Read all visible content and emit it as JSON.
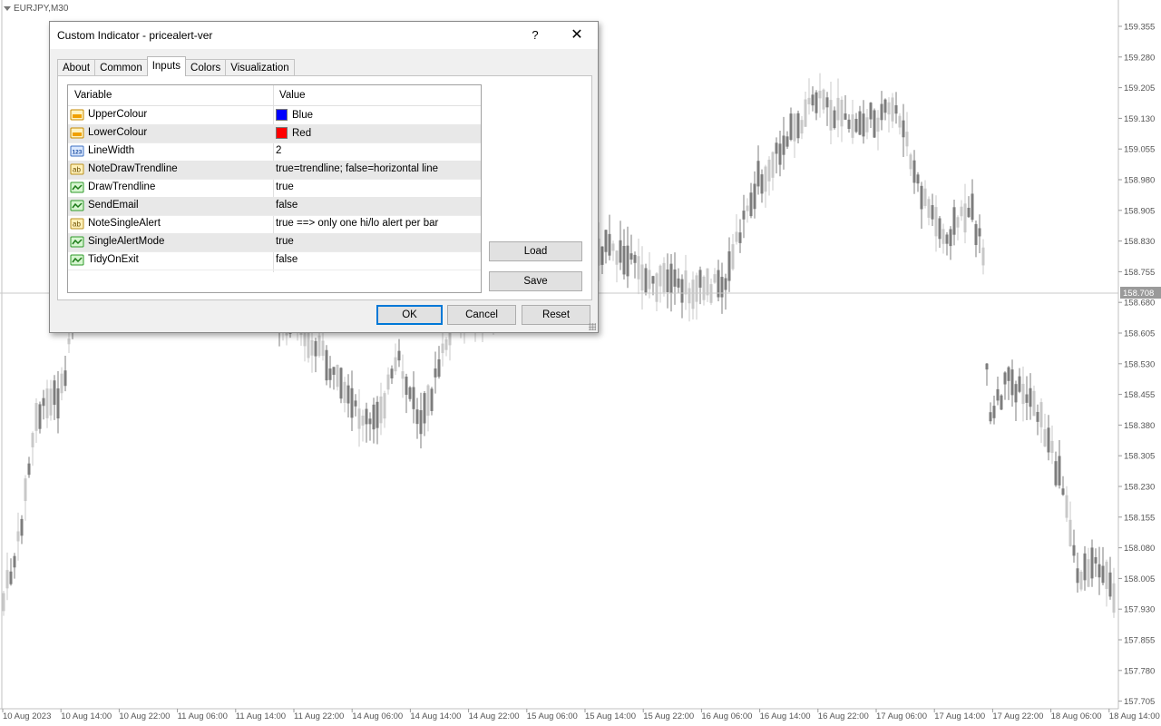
{
  "chart": {
    "symbol": "EURJPY,M30",
    "price_levels": [
      "159.355",
      "159.280",
      "159.205",
      "159.130",
      "159.055",
      "158.980",
      "158.905",
      "158.830",
      "158.755",
      "158.680",
      "158.605",
      "158.530",
      "158.455",
      "158.380",
      "158.305",
      "158.230",
      "158.155",
      "158.080",
      "158.005",
      "157.930",
      "157.855",
      "157.780",
      "157.705"
    ],
    "current_price": "158.708",
    "time_labels": [
      "10 Aug 2023",
      "10 Aug 14:00",
      "10 Aug 22:00",
      "11 Aug 06:00",
      "11 Aug 14:00",
      "11 Aug 22:00",
      "14 Aug 06:00",
      "14 Aug 14:00",
      "14 Aug 22:00",
      "15 Aug 06:00",
      "15 Aug 14:00",
      "15 Aug 22:00",
      "16 Aug 06:00",
      "16 Aug 14:00",
      "16 Aug 22:00",
      "17 Aug 06:00",
      "17 Aug 14:00",
      "17 Aug 22:00",
      "18 Aug 06:00",
      "18 Aug 14:00"
    ],
    "colors": {
      "candle_dark": "#7d7d7d",
      "candle_light": "#c8c8c8",
      "price_tag_bg": "#9a9a9a"
    }
  },
  "dialog": {
    "title": "Custom Indicator - pricealert-ver",
    "help_label": "?",
    "close_label": "✕",
    "tabs": [
      {
        "label": "About"
      },
      {
        "label": "Common"
      },
      {
        "label": "Inputs"
      },
      {
        "label": "Colors"
      },
      {
        "label": "Visualization"
      }
    ],
    "active_tab": "Inputs",
    "grid": {
      "col_variable": "Variable",
      "col_value": "Value",
      "rows": [
        {
          "variable": "UpperColour",
          "value": "Blue",
          "icon": "color-icon",
          "swatch": "#0000ff"
        },
        {
          "variable": "LowerColour",
          "value": "Red",
          "icon": "color-icon",
          "swatch": "#ff0000"
        },
        {
          "variable": "LineWidth",
          "value": "2",
          "icon": "integer-icon"
        },
        {
          "variable": "NoteDrawTrendline",
          "value": "true=trendline; false=horizontal line",
          "icon": "string-icon"
        },
        {
          "variable": "DrawTrendline",
          "value": "true",
          "icon": "bool-icon"
        },
        {
          "variable": "SendEmail",
          "value": "false",
          "icon": "bool-icon"
        },
        {
          "variable": "NoteSingleAlert",
          "value": "true ==> only one hi/lo alert per bar",
          "icon": "string-icon"
        },
        {
          "variable": "SingleAlertMode",
          "value": "true",
          "icon": "bool-icon"
        },
        {
          "variable": "TidyOnExit",
          "value": "false",
          "icon": "bool-icon"
        }
      ]
    },
    "load_label": "Load",
    "save_label": "Save",
    "ok_label": "OK",
    "cancel_label": "Cancel",
    "reset_label": "Reset"
  }
}
